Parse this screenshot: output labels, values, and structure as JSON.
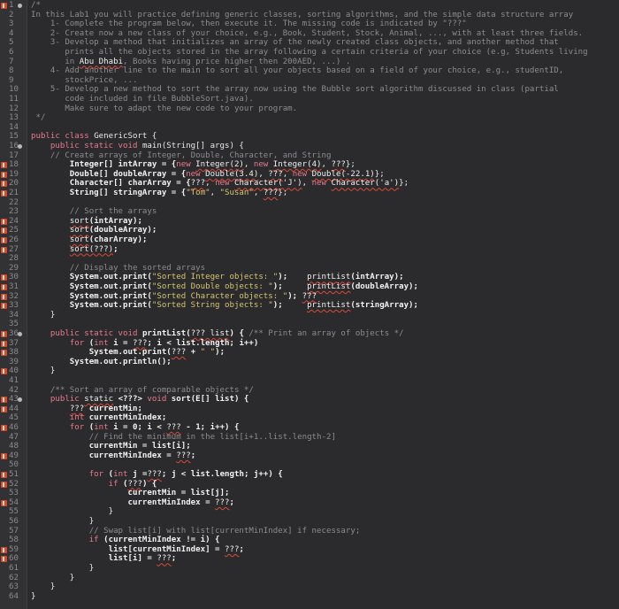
{
  "editor": {
    "language": "java",
    "colors": {
      "background": "#2b2b2d",
      "comment": "#8c8c90",
      "keyword": "#e87a8d",
      "string": "#d6c56f",
      "error_underline": "#d94a3a",
      "error_marker": "#cf4d2f"
    },
    "lines": [
      {
        "n": "1",
        "marker": "error",
        "fold": true,
        "tokens": [
          {
            "t": "/*",
            "c": "cm"
          }
        ]
      },
      {
        "n": "2",
        "tokens": [
          {
            "t": "In this Lab1 you will practice defining generic classes, sorting algorithms, and the simple data structure array",
            "c": "cm"
          }
        ]
      },
      {
        "n": "3",
        "tokens": [
          {
            "t": "    1- Complete the program below, then execute it. The missing code is indicated by \"???\"",
            "c": "cm"
          }
        ]
      },
      {
        "n": "4",
        "tokens": [
          {
            "t": "    2- Create now a new class of your choice, e.g., Book, Student, Stock, Animal, ..., with at least three fields.",
            "c": "cm"
          }
        ]
      },
      {
        "n": "5",
        "tokens": [
          {
            "t": "    3- Develop a method that initializes an array of the newly created class objects, and another method that",
            "c": "cm"
          }
        ]
      },
      {
        "n": "6",
        "tokens": [
          {
            "t": "       prints all the objects stored in the array following a certain criteria of your choice (e.g, Students living",
            "c": "cm"
          }
        ]
      },
      {
        "n": "7",
        "tokens": [
          {
            "t": "       in ",
            "c": "cm"
          },
          {
            "t": "Abu Dhabi",
            "c": "err"
          },
          {
            "t": ", Books having price higher then 200AED, ...) .",
            "c": "cm"
          }
        ]
      },
      {
        "n": "8",
        "tokens": [
          {
            "t": "    4- Add another line to the main to sort all your objects based on a field of your choice, e.g., studentID,",
            "c": "cm"
          }
        ]
      },
      {
        "n": "9",
        "tokens": [
          {
            "t": "       stockPrice, ...",
            "c": "cm"
          }
        ]
      },
      {
        "n": "10",
        "tokens": [
          {
            "t": "    5- Develop a new method to sort the array now using the Bubble sort algorithm discussed in class (partial",
            "c": "cm"
          }
        ]
      },
      {
        "n": "11",
        "tokens": [
          {
            "t": "       code included in file BubbleSort.java).",
            "c": "cm"
          }
        ]
      },
      {
        "n": "12",
        "tokens": [
          {
            "t": "       Make sure to adapt the new code to your program.",
            "c": "cm"
          }
        ]
      },
      {
        "n": "13",
        "tokens": [
          {
            "t": " */",
            "c": "cm"
          }
        ]
      },
      {
        "n": "14",
        "tokens": []
      },
      {
        "n": "15",
        "tokens": [
          {
            "t": "public class ",
            "c": "kw"
          },
          {
            "t": "GenericSort",
            "c": "id"
          },
          {
            "t": " {",
            "c": "pn"
          }
        ]
      },
      {
        "n": "16",
        "fold": true,
        "tokens": [
          {
            "t": "    public static void ",
            "c": "kw"
          },
          {
            "t": "main(String[] args) {",
            "c": "id"
          }
        ]
      },
      {
        "n": "17",
        "tokens": [
          {
            "t": "    // Create arrays of Integer, Double, Character, and String",
            "c": "cm"
          }
        ]
      },
      {
        "n": "18",
        "marker": "error",
        "tokens": [
          {
            "t": "        Integer[] intArray = {",
            "c": "bold"
          },
          {
            "t": "new ",
            "c": "kw"
          },
          {
            "t": "Integer(2)",
            "c": "err"
          },
          {
            "t": ", ",
            "c": "pn"
          },
          {
            "t": "new ",
            "c": "kw"
          },
          {
            "t": "Integer(4)",
            "c": "err"
          },
          {
            "t": ", ",
            "c": "pn"
          },
          {
            "t": "???",
            "c": "err"
          },
          {
            "t": "};",
            "c": "pn"
          }
        ]
      },
      {
        "n": "19",
        "marker": "error",
        "tokens": [
          {
            "t": "        Double[] doubleArray = {",
            "c": "bold"
          },
          {
            "t": "new ",
            "c": "kw"
          },
          {
            "t": "Double(3.4)",
            "c": "err"
          },
          {
            "t": ", ",
            "c": "pn"
          },
          {
            "t": "???",
            "c": "err"
          },
          {
            "t": ", ",
            "c": "pn"
          },
          {
            "t": "new ",
            "c": "kw"
          },
          {
            "t": "Double(-22.1)",
            "c": "err"
          },
          {
            "t": "};",
            "c": "pn"
          }
        ]
      },
      {
        "n": "20",
        "marker": "error",
        "tokens": [
          {
            "t": "        Character[] charArray = {",
            "c": "bold"
          },
          {
            "t": "???",
            "c": "err"
          },
          {
            "t": ", ",
            "c": "pn"
          },
          {
            "t": "new ",
            "c": "kw"
          },
          {
            "t": "Character('J')",
            "c": "err"
          },
          {
            "t": ", ",
            "c": "pn"
          },
          {
            "t": "new ",
            "c": "kw"
          },
          {
            "t": "Character('a')",
            "c": "err"
          },
          {
            "t": "};",
            "c": "pn"
          }
        ]
      },
      {
        "n": "21",
        "marker": "error",
        "tokens": [
          {
            "t": "        String[] stringArray = {",
            "c": "bold"
          },
          {
            "t": "\"Tom\"",
            "c": "st"
          },
          {
            "t": ", ",
            "c": "pn"
          },
          {
            "t": "\"Susan\"",
            "c": "st"
          },
          {
            "t": ", ",
            "c": "pn"
          },
          {
            "t": "???",
            "c": "err"
          },
          {
            "t": "};",
            "c": "pn"
          }
        ]
      },
      {
        "n": "22",
        "tokens": []
      },
      {
        "n": "23",
        "tokens": [
          {
            "t": "        // Sort the arrays",
            "c": "cm"
          }
        ]
      },
      {
        "n": "24",
        "marker": "error",
        "tokens": [
          {
            "t": "        ",
            "c": "pn"
          },
          {
            "t": "sort",
            "c": "err"
          },
          {
            "t": "(intArray);",
            "c": "bold"
          }
        ]
      },
      {
        "n": "25",
        "marker": "error",
        "tokens": [
          {
            "t": "        ",
            "c": "pn"
          },
          {
            "t": "sort",
            "c": "err"
          },
          {
            "t": "(doubleArray);",
            "c": "bold"
          }
        ]
      },
      {
        "n": "26",
        "marker": "error",
        "tokens": [
          {
            "t": "        ",
            "c": "pn"
          },
          {
            "t": "sort",
            "c": "err"
          },
          {
            "t": "(charArray);",
            "c": "bold"
          }
        ]
      },
      {
        "n": "27",
        "marker": "error",
        "tokens": [
          {
            "t": "        ",
            "c": "pn"
          },
          {
            "t": "sort(???)",
            "c": "err"
          },
          {
            "t": ";",
            "c": "bold"
          }
        ]
      },
      {
        "n": "28",
        "tokens": []
      },
      {
        "n": "29",
        "tokens": [
          {
            "t": "        // Display the sorted arrays",
            "c": "cm"
          }
        ]
      },
      {
        "n": "30",
        "marker": "error",
        "tokens": [
          {
            "t": "        System.out.print(",
            "c": "bold"
          },
          {
            "t": "\"Sorted Integer objects: \"",
            "c": "st"
          },
          {
            "t": ");    ",
            "c": "bold"
          },
          {
            "t": "printList",
            "c": "err"
          },
          {
            "t": "(intArray);",
            "c": "bold"
          }
        ]
      },
      {
        "n": "31",
        "marker": "error",
        "tokens": [
          {
            "t": "        System.out.print(",
            "c": "bold"
          },
          {
            "t": "\"Sorted Double objects: \"",
            "c": "st"
          },
          {
            "t": ");     ",
            "c": "bold"
          },
          {
            "t": "printList",
            "c": "err"
          },
          {
            "t": "(doubleArray);",
            "c": "bold"
          }
        ]
      },
      {
        "n": "32",
        "marker": "error",
        "tokens": [
          {
            "t": "        System.out.print(",
            "c": "bold"
          },
          {
            "t": "\"Sorted Character objects: \"",
            "c": "st"
          },
          {
            "t": "); ",
            "c": "bold"
          },
          {
            "t": "???",
            "c": "err"
          }
        ]
      },
      {
        "n": "33",
        "marker": "error",
        "tokens": [
          {
            "t": "        System.out.print(",
            "c": "bold"
          },
          {
            "t": "\"Sorted String objects: \"",
            "c": "st"
          },
          {
            "t": ");     ",
            "c": "bold"
          },
          {
            "t": "printList",
            "c": "err"
          },
          {
            "t": "(stringArray);",
            "c": "bold"
          }
        ]
      },
      {
        "n": "34",
        "tokens": [
          {
            "t": "    }",
            "c": "pn"
          }
        ]
      },
      {
        "n": "35",
        "tokens": []
      },
      {
        "n": "36",
        "marker": "error",
        "fold": true,
        "tokens": [
          {
            "t": "    public static void ",
            "c": "kw"
          },
          {
            "t": "printList(",
            "c": "bold"
          },
          {
            "t": "??? list",
            "c": "err"
          },
          {
            "t": ") { ",
            "c": "bold"
          },
          {
            "t": "/** Print an array of objects */",
            "c": "cm"
          }
        ]
      },
      {
        "n": "37",
        "marker": "error",
        "tokens": [
          {
            "t": "        for ",
            "c": "kw"
          },
          {
            "t": "(",
            "c": "bold"
          },
          {
            "t": "int ",
            "c": "kw"
          },
          {
            "t": "i = ",
            "c": "bold"
          },
          {
            "t": "???",
            "c": "err"
          },
          {
            "t": "; i < list.length; i++)",
            "c": "bold"
          }
        ]
      },
      {
        "n": "38",
        "marker": "error",
        "tokens": [
          {
            "t": "            System.out.print(",
            "c": "bold"
          },
          {
            "t": "???",
            "c": "err"
          },
          {
            "t": " + ",
            "c": "bold"
          },
          {
            "t": "\" \"",
            "c": "st"
          },
          {
            "t": ");",
            "c": "bold"
          }
        ]
      },
      {
        "n": "39",
        "tokens": [
          {
            "t": "        System.out.println();",
            "c": "bold"
          }
        ]
      },
      {
        "n": "40",
        "marker": "error",
        "tokens": [
          {
            "t": "    }",
            "c": "pn"
          }
        ]
      },
      {
        "n": "41",
        "tokens": []
      },
      {
        "n": "42",
        "tokens": [
          {
            "t": "    /** Sort an array of comparable objects */",
            "c": "cm"
          }
        ]
      },
      {
        "n": "43",
        "marker": "error",
        "fold": true,
        "tokens": [
          {
            "t": "    public ",
            "c": "kw"
          },
          {
            "t": "static",
            "c": "err"
          },
          {
            "t": " <???> ",
            "c": "bold"
          },
          {
            "t": "void ",
            "c": "kw"
          },
          {
            "t": "sort(E[] list) {",
            "c": "bold"
          }
        ]
      },
      {
        "n": "44",
        "marker": "error",
        "tokens": [
          {
            "t": "        ",
            "c": "pn"
          },
          {
            "t": "???",
            "c": "err"
          },
          {
            "t": " currentMin;",
            "c": "bold"
          }
        ]
      },
      {
        "n": "45",
        "tokens": [
          {
            "t": "        int ",
            "c": "kw"
          },
          {
            "t": "currentMinIndex;",
            "c": "bold"
          }
        ]
      },
      {
        "n": "46",
        "marker": "error",
        "tokens": [
          {
            "t": "        for ",
            "c": "kw"
          },
          {
            "t": "(",
            "c": "bold"
          },
          {
            "t": "int ",
            "c": "kw"
          },
          {
            "t": "i = 0; i < ",
            "c": "bold"
          },
          {
            "t": "???",
            "c": "err"
          },
          {
            "t": " - 1; i++) {",
            "c": "bold"
          }
        ]
      },
      {
        "n": "47",
        "tokens": [
          {
            "t": "            // Find the minimum in the list[i+1..list.length-2]",
            "c": "cm"
          }
        ]
      },
      {
        "n": "48",
        "tokens": [
          {
            "t": "            currentMin = list[i];",
            "c": "bold"
          }
        ]
      },
      {
        "n": "49",
        "marker": "error",
        "tokens": [
          {
            "t": "            currentMinIndex = ",
            "c": "bold"
          },
          {
            "t": "???",
            "c": "err"
          },
          {
            "t": ";",
            "c": "bold"
          }
        ]
      },
      {
        "n": "50",
        "tokens": []
      },
      {
        "n": "51",
        "marker": "error",
        "tokens": [
          {
            "t": "            for ",
            "c": "kw"
          },
          {
            "t": "(",
            "c": "bold"
          },
          {
            "t": "int ",
            "c": "kw"
          },
          {
            "t": "j =",
            "c": "bold"
          },
          {
            "t": "???",
            "c": "err"
          },
          {
            "t": "; j < list.length; j++) {",
            "c": "bold"
          }
        ]
      },
      {
        "n": "52",
        "marker": "error",
        "tokens": [
          {
            "t": "                if ",
            "c": "kw"
          },
          {
            "t": "(",
            "c": "bold"
          },
          {
            "t": "???",
            "c": "err"
          },
          {
            "t": ") {",
            "c": "bold"
          }
        ]
      },
      {
        "n": "53",
        "tokens": [
          {
            "t": "                    currentMin = list[j];",
            "c": "bold"
          }
        ]
      },
      {
        "n": "54",
        "marker": "error",
        "tokens": [
          {
            "t": "                    currentMinIndex = ",
            "c": "bold"
          },
          {
            "t": "???",
            "c": "err"
          },
          {
            "t": ";",
            "c": "bold"
          }
        ]
      },
      {
        "n": "55",
        "tokens": [
          {
            "t": "                }",
            "c": "pn"
          }
        ]
      },
      {
        "n": "56",
        "tokens": [
          {
            "t": "            }",
            "c": "pn"
          }
        ]
      },
      {
        "n": "57",
        "tokens": [
          {
            "t": "            // Swap list[i] with list[currentMinIndex] if necessary;",
            "c": "cm"
          }
        ]
      },
      {
        "n": "58",
        "tokens": [
          {
            "t": "            if ",
            "c": "kw"
          },
          {
            "t": "(currentMinIndex != i) {",
            "c": "bold"
          }
        ]
      },
      {
        "n": "59",
        "marker": "error",
        "tokens": [
          {
            "t": "                list[currentMinIndex] = ",
            "c": "bold"
          },
          {
            "t": "???",
            "c": "err"
          },
          {
            "t": ";",
            "c": "bold"
          }
        ]
      },
      {
        "n": "60",
        "marker": "error",
        "tokens": [
          {
            "t": "                list[i] = ",
            "c": "bold"
          },
          {
            "t": "???",
            "c": "err"
          },
          {
            "t": ";",
            "c": "bold"
          }
        ]
      },
      {
        "n": "61",
        "tokens": [
          {
            "t": "            }",
            "c": "pn"
          }
        ]
      },
      {
        "n": "62",
        "tokens": [
          {
            "t": "        }",
            "c": "pn"
          }
        ]
      },
      {
        "n": "63",
        "tokens": [
          {
            "t": "    }",
            "c": "pn"
          }
        ]
      },
      {
        "n": "64",
        "tokens": [
          {
            "t": "}",
            "c": "pn"
          }
        ]
      }
    ]
  }
}
